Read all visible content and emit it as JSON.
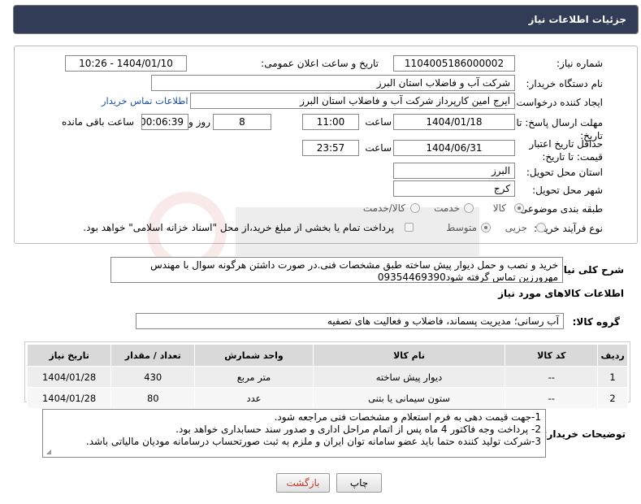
{
  "header": {
    "title": "جزئیات اطلاعات نیاز"
  },
  "form": {
    "need_number_label": "شماره نیاز:",
    "need_number": "1104005186000002",
    "announce_label": "تاریخ و ساعت اعلان عمومی:",
    "announce_value": "1404/01/10 - 10:26",
    "buyer_org_label": "نام دستگاه خریدار:",
    "buyer_org": "شرکت آب و فاضلاب استان البرز",
    "requester_label": "ایجاد کننده درخواست:",
    "requester": "ایرج امین کارپرداز شرکت آب و فاضلاب استان البرز",
    "contact_link": "اطلاعات تماس خریدار",
    "deadline_label": "مهلت ارسال پاسخ: تا تاریخ:",
    "deadline_date": "1404/01/18",
    "time_label": "ساعت",
    "deadline_time": "11:00",
    "days_value": "8",
    "days_label": "روز و",
    "remaining_time": "00:06:39",
    "remaining_label": "ساعت باقی مانده",
    "min_validity_label": "حداقل تاریخ اعتبار قیمت: تا تاریخ:",
    "validity_date": "1404/06/31",
    "validity_time": "23:57",
    "province_label": "استان محل تحویل:",
    "province": "البرز",
    "city_label": "شهر محل تحویل:",
    "city": "کرج",
    "category_label": "طبقه بندی موضوعی:",
    "category_options": [
      "کالا",
      "خدمت",
      "کالا/خدمت"
    ],
    "process_label": "نوع فرآیند خرید :",
    "process_options": [
      "جزیی",
      "متوسط"
    ],
    "payment_note": "پرداخت تمام یا بخشی از مبلغ خرید،از محل \"اسناد خزانه اسلامی\" خواهد بود."
  },
  "description": {
    "label": "شرح کلی نیاز:",
    "text": "خرید و نصب و حمل دیوار پیش ساخته طبق مشخصات فنی.در صورت داشتن هرگونه سوال با مهندس مهرورزین تماس گرفته شود09354469390"
  },
  "goods": {
    "section_title": "اطلاعات کالاهای مورد نیاز",
    "group_label": "گروه کالا:",
    "group_value": "آب رسانی؛ مدیریت پسماند، فاضلاب و فعالیت های تصفیه"
  },
  "table": {
    "headers": [
      "ردیف",
      "کد کالا",
      "نام کالا",
      "واحد شمارش",
      "تعداد / مقدار",
      "تاریخ نیاز"
    ],
    "rows": [
      [
        "1",
        "--",
        "دیوار پیش ساخته",
        "متر مربع",
        "430",
        "1404/01/28"
      ],
      [
        "2",
        "--",
        "ستون سیمانی یا بتنی",
        "عدد",
        "80",
        "1404/01/28"
      ]
    ]
  },
  "buyer_notes": {
    "label": "توضیحات خریدار:",
    "lines": [
      "1-جهت قیمت دهی به فرم استعلام و مشخصات فنی مراجعه شود.",
      "2- پرداخت وجه فاکتور 4 ماه پس از اتمام مراحل اداری و صدور سند حسابداری خواهد بود.",
      "3-شرکت تولید کننده حتما باید عضو سامانه توان ایران و ملزم به ثبت صورتحساب درسامانه مودیان مالیاتی باشد."
    ]
  },
  "buttons": {
    "print": "چاپ",
    "back": "بازگشت"
  },
  "colors": {
    "title_bar": "#333c57",
    "link": "#1c4fa0",
    "back_text": "#c0392b"
  }
}
